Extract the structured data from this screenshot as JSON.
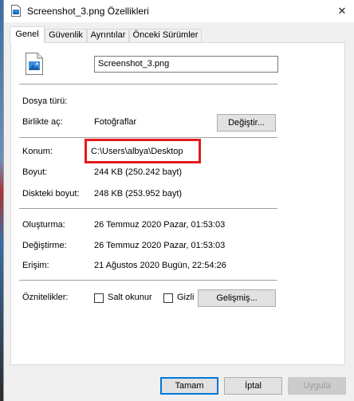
{
  "window": {
    "title": "Screenshot_3.png Özellikleri",
    "close_symbol": "✕"
  },
  "tabs": [
    "Genel",
    "Güvenlik",
    "Ayrıntılar",
    "Önceki Sürümler"
  ],
  "general": {
    "filename": "Screenshot_3.png",
    "file_type_label": "Dosya türü:",
    "file_type_value": "",
    "opens_with_label": "Birlikte aç:",
    "opens_with_value": "Fotoğraflar",
    "change_button": "Değiştir...",
    "location_label": "Konum:",
    "location_value": "C:\\Users\\albya\\Desktop",
    "size_label": "Boyut:",
    "size_value": "244 KB (250.242 bayt)",
    "disk_size_label": "Diskteki boyut:",
    "disk_size_value": "248 KB (253.952 bayt)",
    "created_label": "Oluşturma:",
    "created_value": "26 Temmuz 2020 Pazar, 01:53:03",
    "modified_label": "Değiştirme:",
    "modified_value": "26 Temmuz 2020 Pazar, 01:53:03",
    "accessed_label": "Erişim:",
    "accessed_value": "21 Ağustos 2020 Bugün, 22:54:26",
    "attributes_label": "Öznitelikler:",
    "readonly_label": "Salt okunur",
    "hidden_label": "Gizli",
    "advanced_button": "Gelişmiş..."
  },
  "footer": {
    "ok": "Tamam",
    "cancel": "İptal",
    "apply": "Uygula"
  },
  "colors": {
    "highlight_box": "#e3191c",
    "default_button_border": "#0078d7"
  },
  "icons": {
    "title": "image-file-icon",
    "file": "image-file-icon"
  }
}
